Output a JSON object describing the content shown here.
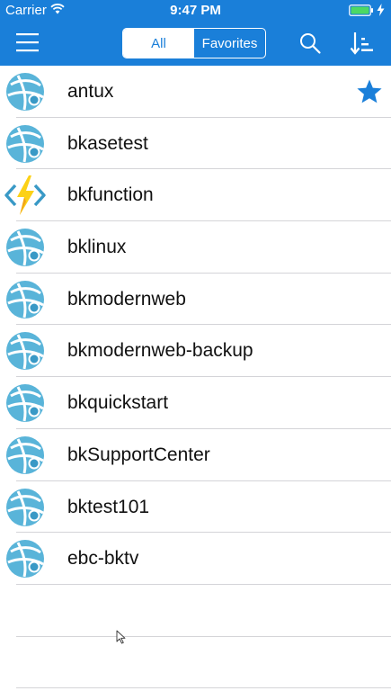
{
  "status_bar": {
    "carrier": "Carrier",
    "time": "9:47 PM"
  },
  "toolbar": {
    "menu_icon": "hamburger-menu-icon",
    "segments": [
      {
        "label": "All",
        "selected": true
      },
      {
        "label": "Favorites",
        "selected": false
      }
    ],
    "search_icon": "search-icon",
    "sort_icon": "sort-icon"
  },
  "list": {
    "items": [
      {
        "name": "antux",
        "icon": "azure-web-app-icon",
        "favorite": true
      },
      {
        "name": "bkasetest",
        "icon": "azure-web-app-icon",
        "favorite": false
      },
      {
        "name": "bkfunction",
        "icon": "azure-function-app-icon",
        "favorite": false
      },
      {
        "name": "bklinux",
        "icon": "azure-web-app-icon",
        "favorite": false
      },
      {
        "name": "bkmodernweb",
        "icon": "azure-web-app-icon",
        "favorite": false
      },
      {
        "name": "bkmodernweb-backup",
        "icon": "azure-web-app-icon",
        "favorite": false
      },
      {
        "name": "bkquickstart",
        "icon": "azure-web-app-icon",
        "favorite": false
      },
      {
        "name": "bkSupportCenter",
        "icon": "azure-web-app-icon",
        "favorite": false
      },
      {
        "name": "bktest101",
        "icon": "azure-web-app-icon",
        "favorite": false
      },
      {
        "name": "ebc-bktv",
        "icon": "azure-web-app-icon",
        "favorite": false
      }
    ]
  },
  "colors": {
    "header": "#1a7fd9",
    "favorite_star": "#1a7fd9",
    "web_app_icon": "#59b4d9",
    "function_bolt": "#fcd116",
    "function_brackets": "#3999c6"
  }
}
